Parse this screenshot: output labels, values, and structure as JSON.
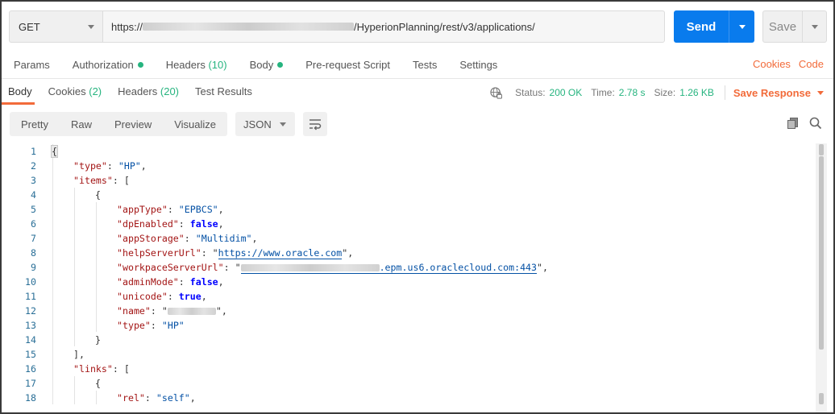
{
  "request": {
    "method": "GET",
    "url_prefix": "https://",
    "url_suffix": "/HyperionPlanning/rest/v3/applications/",
    "send_label": "Send",
    "save_label": "Save"
  },
  "request_tabs": [
    {
      "label": "Params"
    },
    {
      "label": "Authorization",
      "dot": true
    },
    {
      "label": "Headers",
      "count": "(10)"
    },
    {
      "label": "Body",
      "dot": true
    },
    {
      "label": "Pre-request Script"
    },
    {
      "label": "Tests"
    },
    {
      "label": "Settings"
    }
  ],
  "request_links": {
    "cookies": "Cookies",
    "code": "Code"
  },
  "response_tabs": [
    {
      "label": "Body"
    },
    {
      "label": "Cookies",
      "count": "(2)"
    },
    {
      "label": "Headers",
      "count": "(20)"
    },
    {
      "label": "Test Results"
    }
  ],
  "response_meta": {
    "status_label": "Status:",
    "status_value": "200 OK",
    "time_label": "Time:",
    "time_value": "2.78 s",
    "size_label": "Size:",
    "size_value": "1.26 KB",
    "save_response": "Save Response"
  },
  "view_modes": [
    "Pretty",
    "Raw",
    "Preview",
    "Visualize"
  ],
  "format": "JSON",
  "code_lines": [
    {
      "n": "1",
      "parts": [
        {
          "t": "brace",
          "v": "{"
        }
      ]
    },
    {
      "n": "2",
      "indent": 1,
      "parts": [
        {
          "t": "key",
          "v": "\"type\""
        },
        {
          "t": "punc",
          "v": ": "
        },
        {
          "t": "str",
          "v": "\"HP\""
        },
        {
          "t": "punc",
          "v": ","
        }
      ]
    },
    {
      "n": "3",
      "indent": 1,
      "parts": [
        {
          "t": "key",
          "v": "\"items\""
        },
        {
          "t": "punc",
          "v": ": ["
        }
      ]
    },
    {
      "n": "4",
      "indent": 2,
      "parts": [
        {
          "t": "punc",
          "v": "{"
        }
      ]
    },
    {
      "n": "5",
      "indent": 3,
      "parts": [
        {
          "t": "key",
          "v": "\"appType\""
        },
        {
          "t": "punc",
          "v": ": "
        },
        {
          "t": "str",
          "v": "\"EPBCS\""
        },
        {
          "t": "punc",
          "v": ","
        }
      ]
    },
    {
      "n": "6",
      "indent": 3,
      "parts": [
        {
          "t": "key",
          "v": "\"dpEnabled\""
        },
        {
          "t": "punc",
          "v": ": "
        },
        {
          "t": "kw",
          "v": "false"
        },
        {
          "t": "punc",
          "v": ","
        }
      ]
    },
    {
      "n": "7",
      "indent": 3,
      "parts": [
        {
          "t": "key",
          "v": "\"appStorage\""
        },
        {
          "t": "punc",
          "v": ": "
        },
        {
          "t": "str",
          "v": "\"Multidim\""
        },
        {
          "t": "punc",
          "v": ","
        }
      ]
    },
    {
      "n": "8",
      "indent": 3,
      "parts": [
        {
          "t": "key",
          "v": "\"helpServerUrl\""
        },
        {
          "t": "punc",
          "v": ": \""
        },
        {
          "t": "link",
          "v": "https://www.oracle.com"
        },
        {
          "t": "punc",
          "v": "\","
        }
      ]
    },
    {
      "n": "9",
      "indent": 3,
      "parts": [
        {
          "t": "key",
          "v": "\"workpaceServerUrl\""
        },
        {
          "t": "punc",
          "v": ": \""
        },
        {
          "t": "blurlink",
          "v": ".epm.us6.oraclecloud.com:443"
        },
        {
          "t": "punc",
          "v": "\","
        }
      ]
    },
    {
      "n": "10",
      "indent": 3,
      "parts": [
        {
          "t": "key",
          "v": "\"adminMode\""
        },
        {
          "t": "punc",
          "v": ": "
        },
        {
          "t": "kw",
          "v": "false"
        },
        {
          "t": "punc",
          "v": ","
        }
      ]
    },
    {
      "n": "11",
      "indent": 3,
      "parts": [
        {
          "t": "key",
          "v": "\"unicode\""
        },
        {
          "t": "punc",
          "v": ": "
        },
        {
          "t": "kw",
          "v": "true"
        },
        {
          "t": "punc",
          "v": ","
        }
      ]
    },
    {
      "n": "12",
      "indent": 3,
      "parts": [
        {
          "t": "key",
          "v": "\"name\""
        },
        {
          "t": "punc",
          "v": ": \""
        },
        {
          "t": "blur",
          "v": ""
        },
        {
          "t": "punc",
          "v": "\","
        }
      ]
    },
    {
      "n": "13",
      "indent": 3,
      "parts": [
        {
          "t": "key",
          "v": "\"type\""
        },
        {
          "t": "punc",
          "v": ": "
        },
        {
          "t": "str",
          "v": "\"HP\""
        }
      ]
    },
    {
      "n": "14",
      "indent": 2,
      "parts": [
        {
          "t": "punc",
          "v": "}"
        }
      ]
    },
    {
      "n": "15",
      "indent": 1,
      "parts": [
        {
          "t": "punc",
          "v": "],"
        }
      ]
    },
    {
      "n": "16",
      "indent": 1,
      "parts": [
        {
          "t": "key",
          "v": "\"links\""
        },
        {
          "t": "punc",
          "v": ": ["
        }
      ]
    },
    {
      "n": "17",
      "indent": 2,
      "parts": [
        {
          "t": "punc",
          "v": "{"
        }
      ]
    },
    {
      "n": "18",
      "indent": 3,
      "parts": [
        {
          "t": "key",
          "v": "\"rel\""
        },
        {
          "t": "punc",
          "v": ": "
        },
        {
          "t": "str",
          "v": "\"self\""
        },
        {
          "t": "punc",
          "v": ","
        }
      ]
    }
  ],
  "colors": {
    "accent": "#f26b3a",
    "send": "#097bed",
    "success": "#26b47f"
  }
}
